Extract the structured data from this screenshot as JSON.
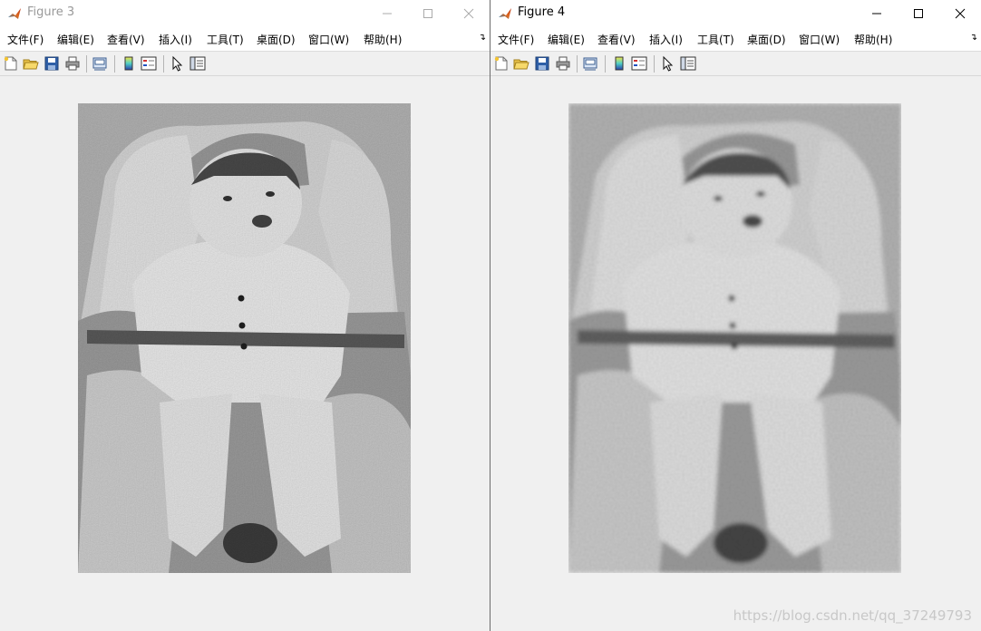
{
  "windows": [
    {
      "title": "Figure 3",
      "active": false,
      "menu": [
        "文件(F)",
        "编辑(E)",
        "查看(V)",
        "插入(I)",
        "工具(T)",
        "桌面(D)",
        "窗口(W)",
        "帮助(H)"
      ],
      "image": {
        "description_name": "baby-photo-noisy",
        "filter": "sharp"
      }
    },
    {
      "title": "Figure 4",
      "active": true,
      "menu": [
        "文件(F)",
        "编辑(E)",
        "查看(V)",
        "插入(I)",
        "工具(T)",
        "桌面(D)",
        "窗口(W)",
        "帮助(H)"
      ],
      "image": {
        "description_name": "baby-photo-smoothed",
        "filter": "blurred"
      }
    }
  ],
  "toolbar_icons": [
    "new-figure-icon",
    "open-file-icon",
    "save-icon",
    "print-icon",
    "print-preview-icon",
    "colorbar-icon",
    "legend-icon",
    "pointer-icon",
    "property-inspector-icon"
  ],
  "menu_overflow_icon": "chevron-overflow-icon",
  "colors": {
    "titlebar": "#ffffff",
    "inactive_title": "#999999",
    "active_title": "#000000",
    "figure_bg": "#f0f0f0"
  },
  "watermark": "https://blog.csdn.net/qq_37249793"
}
